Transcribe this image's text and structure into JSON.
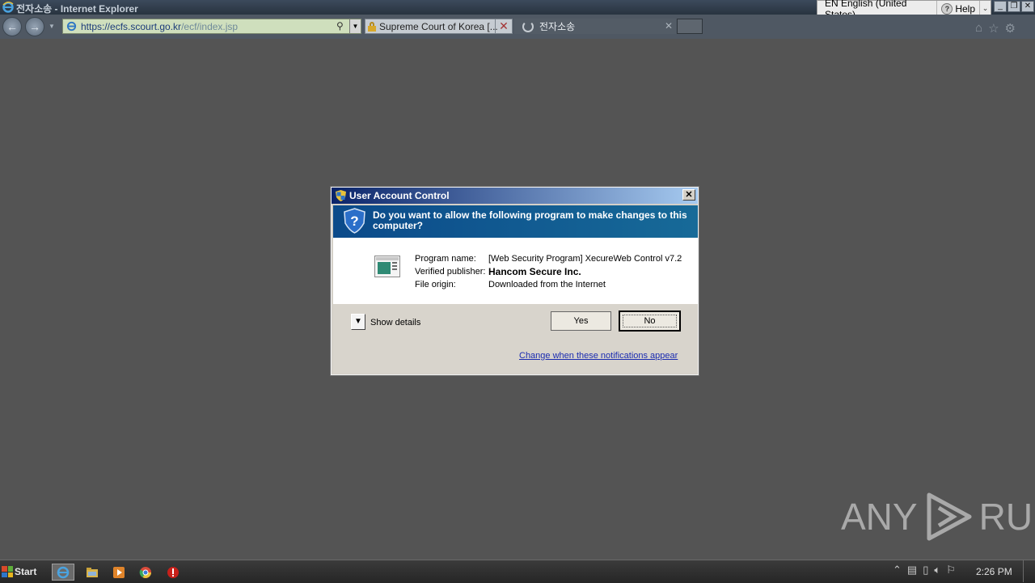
{
  "window": {
    "title": "전자소송 - Internet Explorer",
    "language": "EN English (United States)",
    "help": "Help"
  },
  "browser": {
    "url_host": "https://ecfs.scourt.go.kr",
    "url_path": "/ecf/index.jsp",
    "tabs": [
      {
        "label": "Supreme Court of Korea [...",
        "state": "inactive"
      },
      {
        "label": "전자소송",
        "state": "loading"
      }
    ]
  },
  "uac": {
    "title": "User Account Control",
    "question": "Do you want to allow the following program to make changes to this computer?",
    "fields": {
      "program_name_label": "Program name:",
      "program_name_value": "[Web Security Program] XecureWeb Control v7.2",
      "publisher_label": "Verified publisher:",
      "publisher_value": "Hancom Secure Inc.",
      "origin_label": "File origin:",
      "origin_value": "Downloaded from the Internet"
    },
    "show_details": "Show details",
    "yes": "Yes",
    "no": "No",
    "change_link": "Change when these notifications appear"
  },
  "watermark": {
    "text_left": "ANY",
    "text_right": "RUN"
  },
  "taskbar": {
    "start": "Start",
    "clock": "2:26 PM",
    "items": [
      "internet-explorer",
      "file-explorer",
      "media-player",
      "chrome",
      "stop-sign"
    ]
  },
  "colors": {
    "desktop_bg": "#545454",
    "uac_banner": "#0b4a8a",
    "link": "#1a2bb0"
  }
}
